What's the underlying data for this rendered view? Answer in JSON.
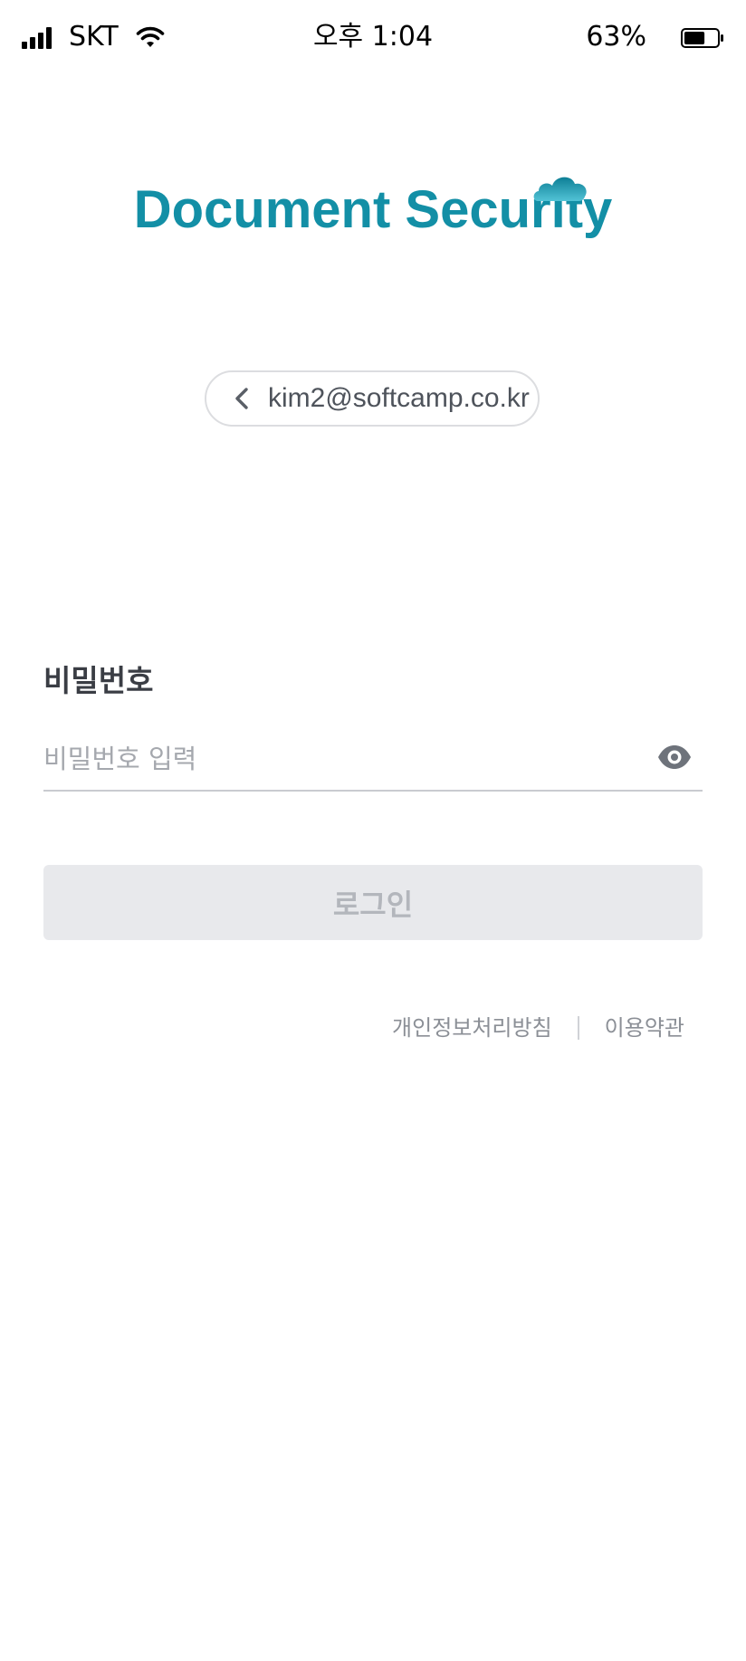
{
  "status_bar": {
    "carrier": "SKT",
    "time": "오후 1:04",
    "battery_percent": "63%",
    "battery_level": 0.63,
    "icons": [
      "signal-icon",
      "wifi-icon",
      "battery-icon"
    ]
  },
  "logo": {
    "text": "Document Security",
    "color": "#138fa6",
    "icon": "cloud-icon"
  },
  "account": {
    "email": "kim2@softcamp.co.kr",
    "back_icon": "chevron-left-icon"
  },
  "password": {
    "label": "비밀번호",
    "placeholder": "비밀번호 입력",
    "value": "",
    "toggle_icon": "eye-icon"
  },
  "login": {
    "label": "로그인",
    "enabled": false
  },
  "footer": {
    "privacy_label": "개인정보처리방침",
    "terms_label": "이용약관"
  }
}
